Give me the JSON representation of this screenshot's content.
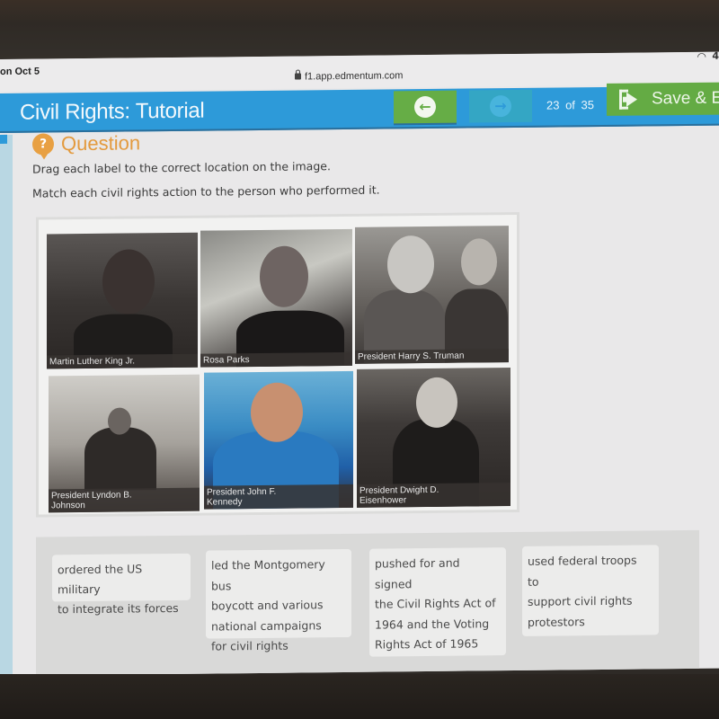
{
  "status_bar": {
    "date": "on Oct 5",
    "url": "f1.app.edmentum.com",
    "battery_text": "4"
  },
  "header": {
    "title": "Civil Rights: Tutorial",
    "back_icon": "arrow-left-circle-icon",
    "forward_icon": "arrow-right-circle-icon",
    "page_counter": "23 of 35",
    "save_exit_label": "Save & Ex",
    "save_exit_icon": "exit-door-icon"
  },
  "question": {
    "heading": "Question",
    "icon_glyph": "?",
    "instructions": [
      "Drag each label to the correct location on the image.",
      "Match each civil rights action to the person who performed it."
    ]
  },
  "photos": [
    {
      "caption": "Martin Luther King Jr."
    },
    {
      "caption": "Rosa Parks"
    },
    {
      "caption": "President Harry S. Truman"
    },
    {
      "caption": "President Lyndon B.\nJohnson"
    },
    {
      "caption": "President John F.\nKennedy"
    },
    {
      "caption": "President Dwight D.\nEisenhower"
    }
  ],
  "drag_labels": [
    {
      "text": "ordered the US military\nto integrate its forces"
    },
    {
      "text": "led the Montgomery bus\nboycott and various\nnational campaigns\nfor civil rights"
    },
    {
      "text": "pushed for and\nsigned\nthe Civil Rights Act of\n1964 and the Voting\nRights Act of 1965"
    },
    {
      "text": "used federal troops\nto\nsupport civil rights\nprotestors"
    }
  ],
  "colors": {
    "header_blue": "#2d9ad9",
    "nav_green": "#66ad46",
    "forward_teal": "#34a6c4",
    "question_orange": "#e39a3e"
  }
}
